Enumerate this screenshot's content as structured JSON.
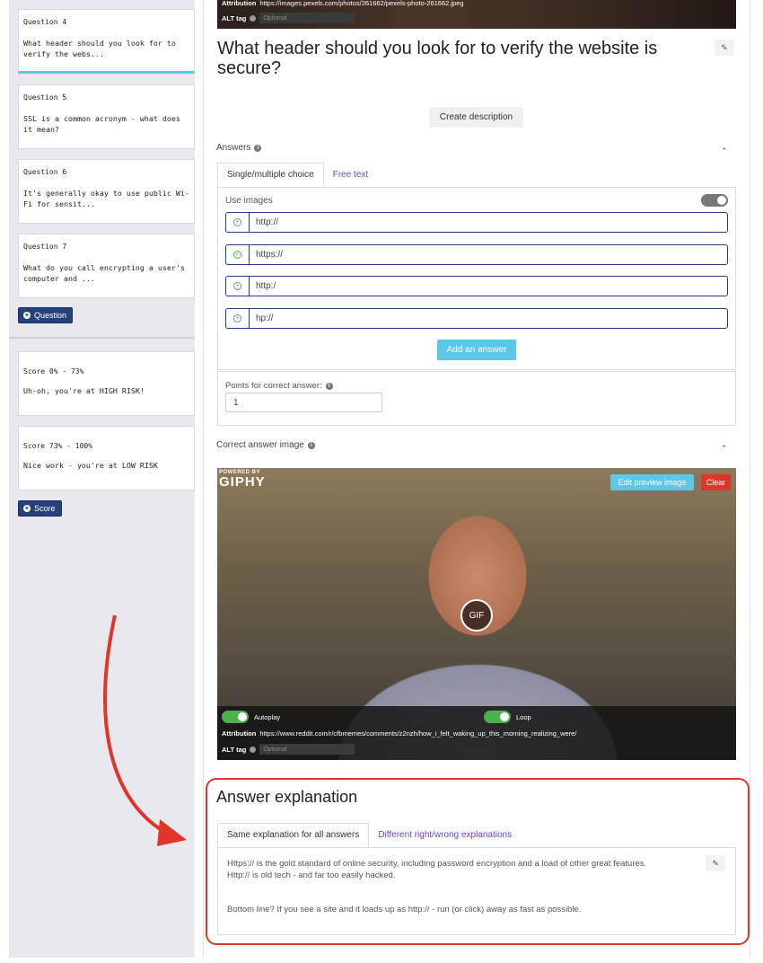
{
  "sidebar": {
    "questions": [
      {
        "label": "Question 4",
        "text": "What header should you look for to verify the webs..."
      },
      {
        "label": "Question 5",
        "text": "SSL is a common acronym - what does it mean?"
      },
      {
        "label": "Question 6",
        "text": "It's generally okay to use public Wi-Fi for sensit..."
      },
      {
        "label": "Question 7",
        "text": "What do you call encrypting a user's computer and ..."
      }
    ],
    "add_question_label": "Question",
    "scores": [
      {
        "label": "Score 0% - 73%",
        "text": "Uh-oh, you're at HIGH RISK!"
      },
      {
        "label": "Score 73% - 100%",
        "text": "Nice work - you're at LOW RISK"
      }
    ],
    "add_score_label": "Score"
  },
  "top_image": {
    "attribution_label": "Attribution",
    "attribution_url": "https://images.pexels.com/photos/261662/pexels-photo-261662.jpeg",
    "alt_label": "ALT tag",
    "alt_placeholder": "Optional"
  },
  "question": {
    "title": "What header should you look for to verify the website is secure?",
    "create_description_label": "Create description"
  },
  "answers": {
    "section_label": "Answers",
    "tabs": [
      "Single/multiple choice",
      "Free text"
    ],
    "use_images_label": "Use images",
    "items": [
      {
        "value": "http://",
        "correct": false
      },
      {
        "value": "https://",
        "correct": true
      },
      {
        "value": "http:/",
        "correct": false
      },
      {
        "value": "hp://",
        "correct": false
      }
    ],
    "add_answer_label": "Add an answer",
    "points_label": "Points for correct answer:",
    "points_value": "1"
  },
  "correct_image": {
    "section_label": "Correct answer image",
    "logo_small": "POWERED BY",
    "logo_big": "GIPHY",
    "edit_preview_label": "Edit preview image",
    "clear_label": "Clear",
    "gif_label": "GIF",
    "autoplay_label": "Autoplay",
    "loop_label": "Loop",
    "attribution_label": "Attribution",
    "attribution_url": "https://www.reddit.com/r/cfbmemes/comments/z2nzh/how_i_felt_waking_up_this_morning_realizing_were/",
    "alt_label": "ALT tag",
    "alt_placeholder": "Optional"
  },
  "explanation": {
    "title": "Answer explanation",
    "tabs": [
      "Same explanation for all answers",
      "Different right/wrong explanations"
    ],
    "paragraph1_line1": "Https:// is the gold standard of online security, including password encryption and a load of other great features.",
    "paragraph1_line2": "Http:// is old tech - and far too easily hacked.",
    "paragraph2": "Bottom line? If you see a site and it loads up as http:// - run (or click) away as fast as possible."
  },
  "colors": {
    "accent": "#5bc8ea",
    "navy": "#26407a",
    "highlight": "#e0362a",
    "link": "#6a44c8"
  }
}
